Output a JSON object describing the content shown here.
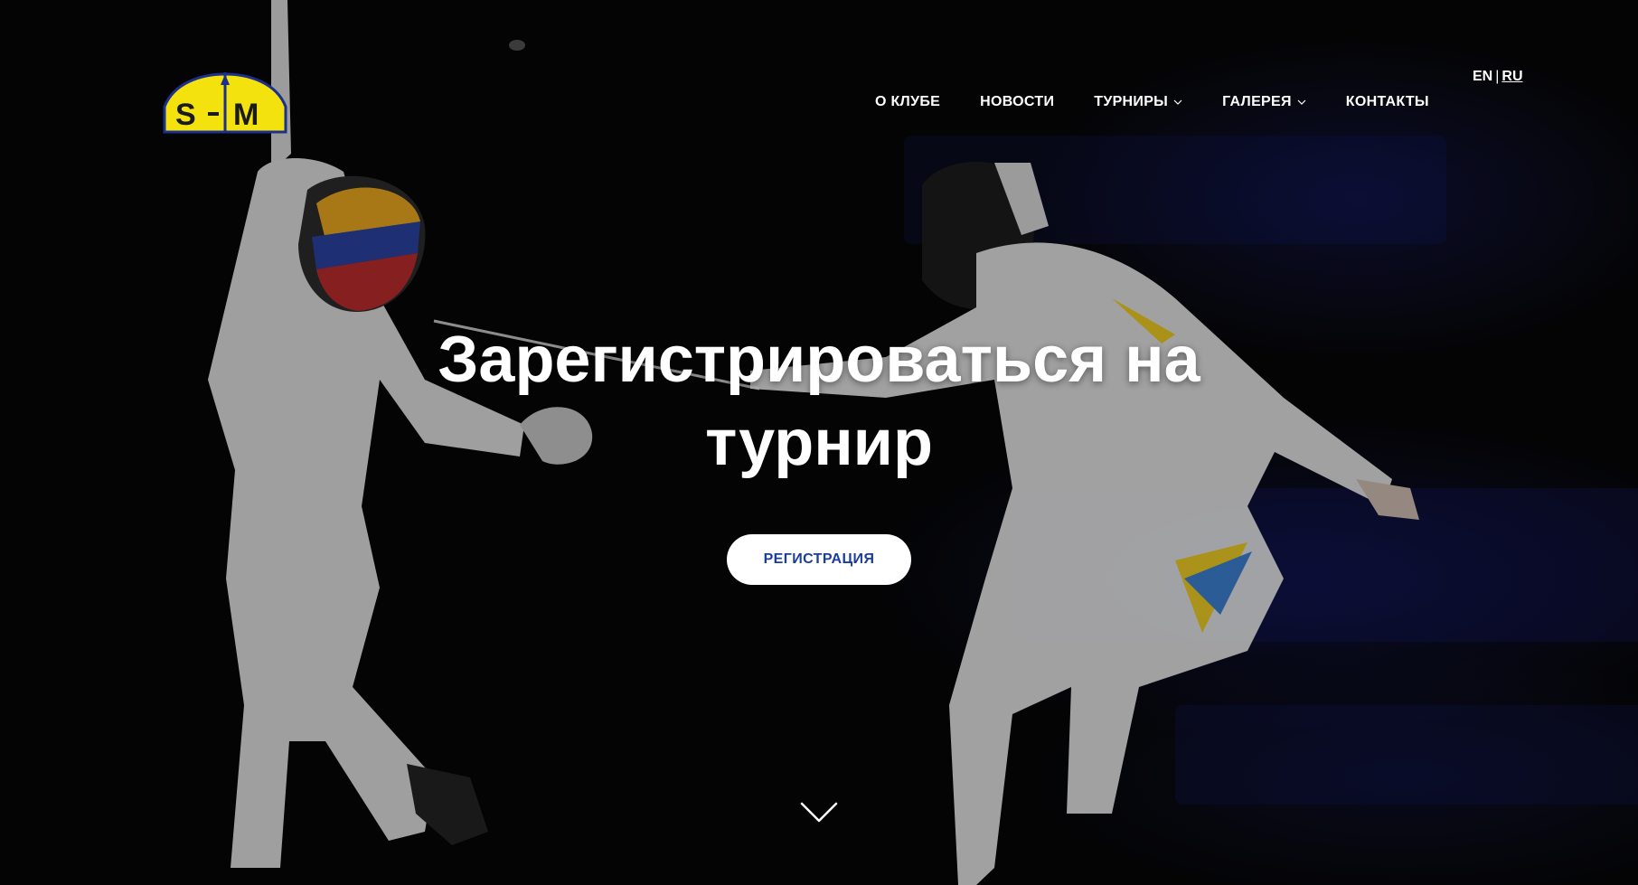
{
  "logo": {
    "text": "S+M",
    "icon": "club-logo-icon",
    "colors": {
      "fill": "#f4e20f",
      "stroke": "#1b2f8c",
      "text": "#1a1a1a"
    }
  },
  "nav": {
    "items": [
      {
        "label": "О КЛУБЕ",
        "has_dropdown": false
      },
      {
        "label": "НОВОСТИ",
        "has_dropdown": false
      },
      {
        "label": "ТУРНИРЫ",
        "has_dropdown": true
      },
      {
        "label": "ГАЛЕРЕЯ",
        "has_dropdown": true
      },
      {
        "label": "КОНТАКТЫ",
        "has_dropdown": false
      }
    ]
  },
  "language": {
    "en": "EN",
    "separator": "|",
    "ru": "RU",
    "active": "RU"
  },
  "hero": {
    "headline_line1": "Зарегистрироваться на",
    "headline_line2": "турнир",
    "button_label": "РЕГИСТРАЦИЯ",
    "scroll_icon": "chevron-down-icon",
    "background": "fencing-match-photo"
  },
  "colors": {
    "button_text": "#1a3e9a",
    "button_bg": "#ffffff",
    "text": "#ffffff",
    "background": "#060606"
  }
}
